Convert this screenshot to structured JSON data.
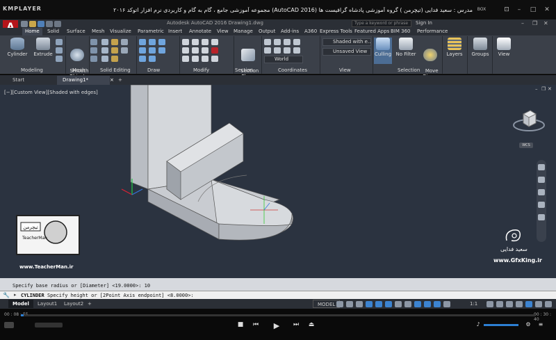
{
  "player": {
    "logo": "KMPLAYER",
    "title": "مجموعه آموزشی جامع ، گام به گام و کاربردی نرم افزار اتوکد ۲۰۱۶ (AutoCAD 2016) مدرس : سعید فدایی (تیچرمن ) گروه آموزشی پادشاه گرافیست ها",
    "box_label": "BOX",
    "time_elapsed": "00 : 08 : 55",
    "time_total": "00 : 30 : 40"
  },
  "app": {
    "logo": "A",
    "title": "Autodesk AutoCAD 2016   Drawing1.dwg",
    "search_placeholder": "Type a keyword or phrase",
    "sign_in": "Sign In"
  },
  "ribbon_tabs": [
    "Home",
    "Solid",
    "Surface",
    "Mesh",
    "Visualize",
    "Parametric",
    "Insert",
    "Annotate",
    "View",
    "Manage",
    "Output",
    "Add-ins",
    "A360",
    "Express Tools",
    "Featured Apps",
    "BIM 360",
    "Performance"
  ],
  "ribbon": {
    "buttons": {
      "cylinder": "Cylinder",
      "extrude": "Extrude",
      "smooth_object": "Smooth\nObject",
      "section_plane": "Section\nPlane",
      "culling": "Culling",
      "no_filter": "No Filter",
      "move_gizmo": "Move\nGizmo",
      "layers": "Layers",
      "groups": "Groups",
      "view": "View"
    },
    "dropdowns": {
      "visual_style": "Shaded with e...",
      "saved_view": "Unsaved View",
      "ucs": "World"
    },
    "groups": [
      "Modeling",
      "Mesh",
      "Solid Editing",
      "Draw",
      "Modify",
      "Section",
      "Coordinates",
      "View",
      "Selection"
    ]
  },
  "file_tabs": {
    "start": "Start",
    "drawing": "Drawing1*",
    "add": "+"
  },
  "viewport": {
    "label": "[−][Custom View][Shaded with edges]",
    "wcs": "WCS"
  },
  "command": {
    "history": "Specify base radius or [Diameter] <19.0000>: 10",
    "prompt_name": "CYLINDER",
    "prompt_text": "Specify height or [2Point Axis endpoint] <8.0000>:"
  },
  "layout_tabs": {
    "model": "Model",
    "layout1": "Layout1",
    "layout2": "Layout2",
    "add": "+"
  },
  "status": {
    "model": "MODEL",
    "scale": "1:1"
  },
  "watermarks": {
    "site": "www.TeacherMan.ir",
    "gfx": "www.GfxKing.ir",
    "badge_name": "TeacherMan",
    "badge_name_fa": "تیچرمن",
    "signature_fa": "سعید فدایی"
  }
}
